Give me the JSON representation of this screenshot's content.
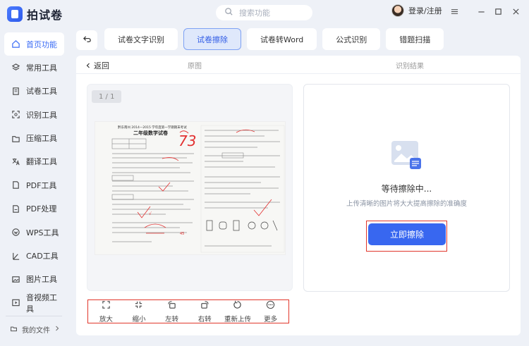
{
  "app": {
    "name": "拍试卷"
  },
  "sidebar": {
    "items": [
      {
        "label": "首页功能",
        "icon": "home-icon",
        "active": true
      },
      {
        "label": "常用工具",
        "icon": "layers-icon"
      },
      {
        "label": "试卷工具",
        "icon": "document-icon"
      },
      {
        "label": "识别工具",
        "icon": "scan-icon"
      },
      {
        "label": "压缩工具",
        "icon": "compress-icon"
      },
      {
        "label": "翻译工具",
        "icon": "translate-icon"
      },
      {
        "label": "PDF工具",
        "icon": "pdf-icon"
      },
      {
        "label": "PDF处理",
        "icon": "pdf-process-icon"
      },
      {
        "label": "WPS工具",
        "icon": "wps-icon"
      },
      {
        "label": "CAD工具",
        "icon": "cad-icon"
      },
      {
        "label": "图片工具",
        "icon": "image-icon"
      },
      {
        "label": "音视频工具",
        "icon": "media-icon"
      }
    ],
    "my_files": "我的文件"
  },
  "topbar": {
    "search_placeholder": "搜索功能",
    "login_label": "登录/注册"
  },
  "tabs": [
    {
      "label": "试卷文字识别"
    },
    {
      "label": "试卷擦除",
      "active": true
    },
    {
      "label": "试卷转Word"
    },
    {
      "label": "公式识别"
    },
    {
      "label": "错题扫描"
    }
  ],
  "panel": {
    "back_label": "返回",
    "original_label": "原图",
    "result_label": "识别结果",
    "page_indicator": "1 / 1",
    "waiting_text": "等待擦除中...",
    "hint_text": "上传清晰的图片将大大提高擦除的准确度",
    "erase_button": "立即擦除"
  },
  "exam": {
    "header_line": "黔东南州 2014—2015 学年度第一学期期末考试",
    "title": "二年级数学试卷",
    "score": "73"
  },
  "toolbar": [
    {
      "label": "放大",
      "icon": "expand-icon"
    },
    {
      "label": "缩小",
      "icon": "shrink-icon"
    },
    {
      "label": "左转",
      "icon": "rotate-left-icon"
    },
    {
      "label": "右转",
      "icon": "rotate-right-icon"
    },
    {
      "label": "重新上传",
      "icon": "reupload-icon"
    },
    {
      "label": "更多",
      "icon": "more-icon"
    }
  ],
  "colors": {
    "accent": "#3867f0",
    "highlight": "#e1362b",
    "score": "#e23030"
  }
}
